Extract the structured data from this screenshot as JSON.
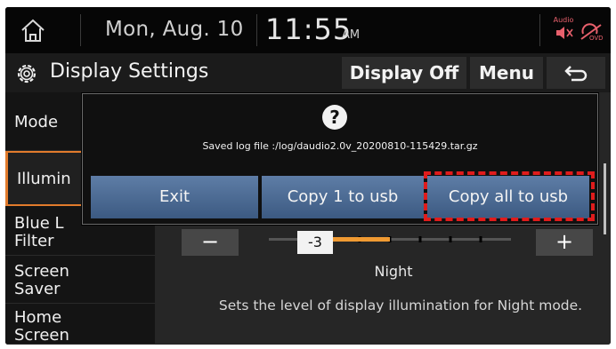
{
  "status": {
    "date": "Mon, Aug. 10",
    "time": "11:55",
    "ampm": "AM",
    "audio_label": "Audio",
    "home_icon": "home-icon",
    "audio_off_icon": "speaker-muted-icon",
    "mic_icon": "mic-off-icon"
  },
  "titlebar": {
    "title": "Display Settings",
    "display_off": "Display Off",
    "menu": "Menu",
    "back_icon": "back-arrow-icon"
  },
  "sidebar": {
    "items": [
      {
        "label": "Mode"
      },
      {
        "label": "Illumin"
      },
      {
        "label": "Blue L\nFilter"
      },
      {
        "label": "Screen\nSaver"
      },
      {
        "label": "Home\nScreen"
      }
    ]
  },
  "illumination": {
    "value": "-3",
    "mode": "Night",
    "description": "Sets the level of display illumination for Night mode.",
    "minus": "−",
    "plus": "+"
  },
  "dialog": {
    "icon": "?",
    "message": "Saved log file :/log/daudio2.0v_20200810-115429.tar.gz",
    "exit": "Exit",
    "copy_one": "Copy 1 to usb",
    "copy_all": "Copy all to usb"
  },
  "colors": {
    "accent": "#f09a32",
    "dialog_button": "#4a6a94",
    "highlight": "#e01c1c"
  }
}
